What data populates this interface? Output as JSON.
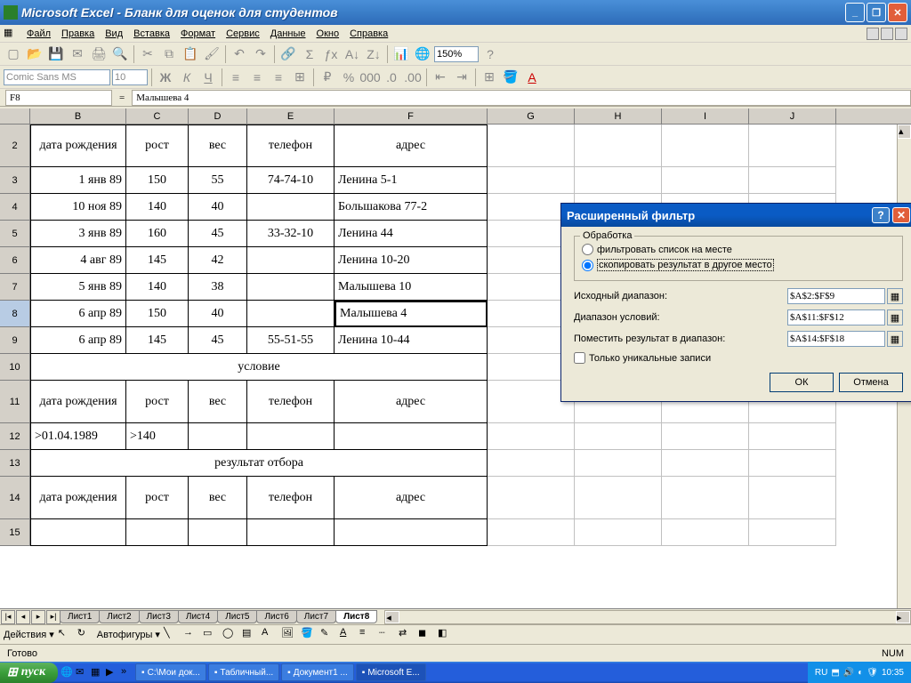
{
  "app": {
    "title": "Microsoft Excel - Бланк для оценок для студентов"
  },
  "menu": [
    "Файл",
    "Правка",
    "Вид",
    "Вставка",
    "Формат",
    "Сервис",
    "Данные",
    "Окно",
    "Справка"
  ],
  "font": {
    "name": "Comic Sans MS",
    "size": "10"
  },
  "zoom": "150%",
  "namebox": "F8",
  "formula": "Малышева 4",
  "columns": [
    "B",
    "C",
    "D",
    "E",
    "F",
    "G",
    "H",
    "I",
    "J"
  ],
  "headers": [
    "дата рождения",
    "рост",
    "вес",
    "телефон",
    "адрес"
  ],
  "data_rows": [
    {
      "n": "3",
      "b": "1 янв 89",
      "c": "150",
      "d": "55",
      "e": "74-74-10",
      "f": "Ленина 5-1"
    },
    {
      "n": "4",
      "b": "10 ноя 89",
      "c": "140",
      "d": "40",
      "e": "",
      "f": "Большакова 77-2"
    },
    {
      "n": "5",
      "b": "3 янв 89",
      "c": "160",
      "d": "45",
      "e": "33-32-10",
      "f": "Ленина 44"
    },
    {
      "n": "6",
      "b": "4 авг 89",
      "c": "145",
      "d": "42",
      "e": "",
      "f": "Ленина 10-20"
    },
    {
      "n": "7",
      "b": "5 янв 89",
      "c": "140",
      "d": "38",
      "e": "",
      "f": "Малышева 10"
    },
    {
      "n": "8",
      "b": "6 апр 89",
      "c": "150",
      "d": "40",
      "e": "",
      "f": "Малышева 4"
    },
    {
      "n": "9",
      "b": "6 апр 89",
      "c": "145",
      "d": "45",
      "e": "55-51-55",
      "f": "Ленина 10-44"
    }
  ],
  "section_condition": "условие",
  "condition_row": {
    "b": ">01.04.1989",
    "c": ">140"
  },
  "section_result": "результат отбора",
  "sheets": [
    "Лист1",
    "Лист2",
    "Лист3",
    "Лист4",
    "Лист5",
    "Лист6",
    "Лист7",
    "Лист8"
  ],
  "active_sheet": "Лист8",
  "draw": {
    "actions": "Действия",
    "autoshapes": "Автофигуры"
  },
  "status": "Готово",
  "status_right": "NUM",
  "dialog": {
    "title": "Расширенный фильтр",
    "group": "Обработка",
    "radio1": "фильтровать список на месте",
    "radio2": "скопировать результат в другое место",
    "lbl_source": "Исходный диапазон:",
    "lbl_criteria": "Диапазон условий:",
    "lbl_copy": "Поместить результат в диапазон:",
    "val_source": "$A$2:$F$9",
    "val_criteria": "$A$11:$F$12",
    "val_copy": "$A$14:$F$18",
    "unique": "Только уникальные записи",
    "ok": "ОК",
    "cancel": "Отмена"
  },
  "taskbar": {
    "start": "пуск",
    "items": [
      "С:\\Мои док...",
      "Табличный...",
      "Документ1 ...",
      "Microsoft E..."
    ],
    "lang": "RU",
    "time": "10:35"
  }
}
